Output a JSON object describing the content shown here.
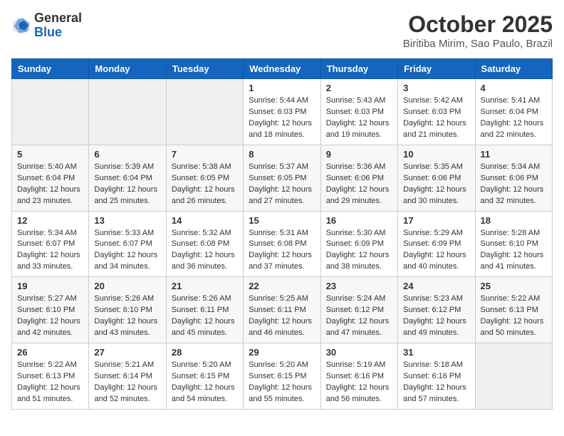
{
  "header": {
    "logo_general": "General",
    "logo_blue": "Blue",
    "month": "October 2025",
    "location": "Biritiba Mirim, Sao Paulo, Brazil"
  },
  "days_of_week": [
    "Sunday",
    "Monday",
    "Tuesday",
    "Wednesday",
    "Thursday",
    "Friday",
    "Saturday"
  ],
  "weeks": [
    [
      {
        "day": "",
        "content": ""
      },
      {
        "day": "",
        "content": ""
      },
      {
        "day": "",
        "content": ""
      },
      {
        "day": "1",
        "content": "Sunrise: 5:44 AM\nSunset: 6:03 PM\nDaylight: 12 hours and 18 minutes."
      },
      {
        "day": "2",
        "content": "Sunrise: 5:43 AM\nSunset: 6:03 PM\nDaylight: 12 hours and 19 minutes."
      },
      {
        "day": "3",
        "content": "Sunrise: 5:42 AM\nSunset: 6:03 PM\nDaylight: 12 hours and 21 minutes."
      },
      {
        "day": "4",
        "content": "Sunrise: 5:41 AM\nSunset: 6:04 PM\nDaylight: 12 hours and 22 minutes."
      }
    ],
    [
      {
        "day": "5",
        "content": "Sunrise: 5:40 AM\nSunset: 6:04 PM\nDaylight: 12 hours and 23 minutes."
      },
      {
        "day": "6",
        "content": "Sunrise: 5:39 AM\nSunset: 6:04 PM\nDaylight: 12 hours and 25 minutes."
      },
      {
        "day": "7",
        "content": "Sunrise: 5:38 AM\nSunset: 6:05 PM\nDaylight: 12 hours and 26 minutes."
      },
      {
        "day": "8",
        "content": "Sunrise: 5:37 AM\nSunset: 6:05 PM\nDaylight: 12 hours and 27 minutes."
      },
      {
        "day": "9",
        "content": "Sunrise: 5:36 AM\nSunset: 6:06 PM\nDaylight: 12 hours and 29 minutes."
      },
      {
        "day": "10",
        "content": "Sunrise: 5:35 AM\nSunset: 6:06 PM\nDaylight: 12 hours and 30 minutes."
      },
      {
        "day": "11",
        "content": "Sunrise: 5:34 AM\nSunset: 6:06 PM\nDaylight: 12 hours and 32 minutes."
      }
    ],
    [
      {
        "day": "12",
        "content": "Sunrise: 5:34 AM\nSunset: 6:07 PM\nDaylight: 12 hours and 33 minutes."
      },
      {
        "day": "13",
        "content": "Sunrise: 5:33 AM\nSunset: 6:07 PM\nDaylight: 12 hours and 34 minutes."
      },
      {
        "day": "14",
        "content": "Sunrise: 5:32 AM\nSunset: 6:08 PM\nDaylight: 12 hours and 36 minutes."
      },
      {
        "day": "15",
        "content": "Sunrise: 5:31 AM\nSunset: 6:08 PM\nDaylight: 12 hours and 37 minutes."
      },
      {
        "day": "16",
        "content": "Sunrise: 5:30 AM\nSunset: 6:09 PM\nDaylight: 12 hours and 38 minutes."
      },
      {
        "day": "17",
        "content": "Sunrise: 5:29 AM\nSunset: 6:09 PM\nDaylight: 12 hours and 40 minutes."
      },
      {
        "day": "18",
        "content": "Sunrise: 5:28 AM\nSunset: 6:10 PM\nDaylight: 12 hours and 41 minutes."
      }
    ],
    [
      {
        "day": "19",
        "content": "Sunrise: 5:27 AM\nSunset: 6:10 PM\nDaylight: 12 hours and 42 minutes."
      },
      {
        "day": "20",
        "content": "Sunrise: 5:26 AM\nSunset: 6:10 PM\nDaylight: 12 hours and 43 minutes."
      },
      {
        "day": "21",
        "content": "Sunrise: 5:26 AM\nSunset: 6:11 PM\nDaylight: 12 hours and 45 minutes."
      },
      {
        "day": "22",
        "content": "Sunrise: 5:25 AM\nSunset: 6:11 PM\nDaylight: 12 hours and 46 minutes."
      },
      {
        "day": "23",
        "content": "Sunrise: 5:24 AM\nSunset: 6:12 PM\nDaylight: 12 hours and 47 minutes."
      },
      {
        "day": "24",
        "content": "Sunrise: 5:23 AM\nSunset: 6:12 PM\nDaylight: 12 hours and 49 minutes."
      },
      {
        "day": "25",
        "content": "Sunrise: 5:22 AM\nSunset: 6:13 PM\nDaylight: 12 hours and 50 minutes."
      }
    ],
    [
      {
        "day": "26",
        "content": "Sunrise: 5:22 AM\nSunset: 6:13 PM\nDaylight: 12 hours and 51 minutes."
      },
      {
        "day": "27",
        "content": "Sunrise: 5:21 AM\nSunset: 6:14 PM\nDaylight: 12 hours and 52 minutes."
      },
      {
        "day": "28",
        "content": "Sunrise: 5:20 AM\nSunset: 6:15 PM\nDaylight: 12 hours and 54 minutes."
      },
      {
        "day": "29",
        "content": "Sunrise: 5:20 AM\nSunset: 6:15 PM\nDaylight: 12 hours and 55 minutes."
      },
      {
        "day": "30",
        "content": "Sunrise: 5:19 AM\nSunset: 6:16 PM\nDaylight: 12 hours and 56 minutes."
      },
      {
        "day": "31",
        "content": "Sunrise: 5:18 AM\nSunset: 6:16 PM\nDaylight: 12 hours and 57 minutes."
      },
      {
        "day": "",
        "content": ""
      }
    ]
  ]
}
